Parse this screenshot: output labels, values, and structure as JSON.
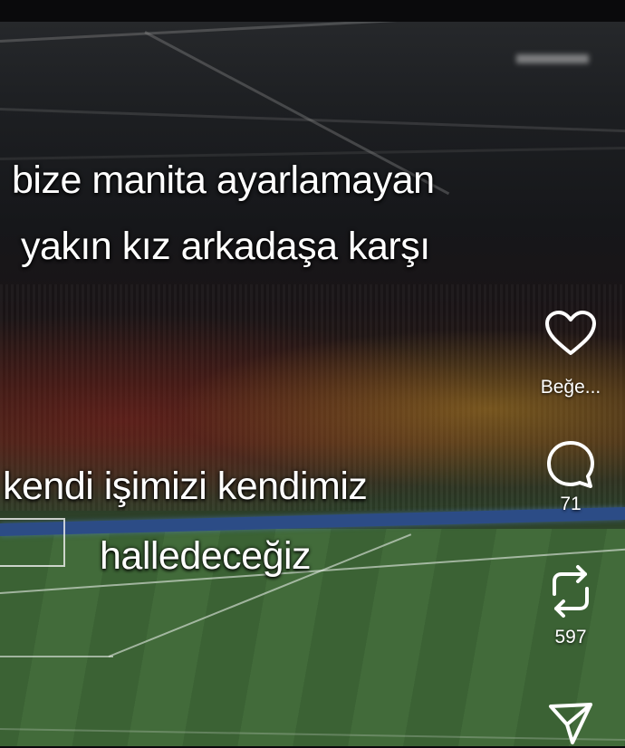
{
  "captions": {
    "line1": "bize manita ayarlamayan",
    "line2": "yakın kız arkadaşa karşı",
    "line3": "kendi işimizi kendimiz",
    "line4": "halledeceğiz"
  },
  "actions": {
    "like_label": "Beğe...",
    "comment_count": "71",
    "repost_count": "597"
  },
  "icons": [
    "heart-icon",
    "comment-icon",
    "repost-icon",
    "share-icon"
  ],
  "colors": {
    "icon": "#ffffff",
    "text": "#ffffff"
  }
}
